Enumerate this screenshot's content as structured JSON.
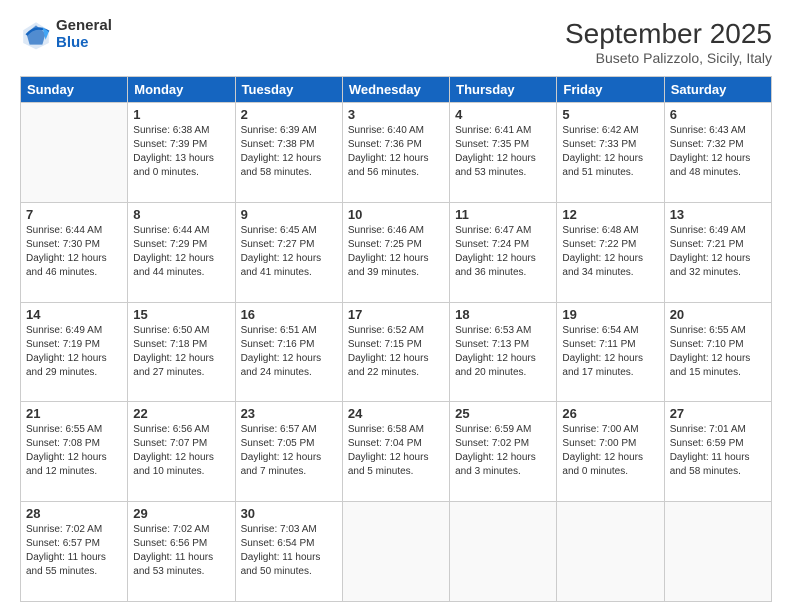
{
  "header": {
    "logo_general": "General",
    "logo_blue": "Blue",
    "month_title": "September 2025",
    "location": "Buseto Palizzolo, Sicily, Italy"
  },
  "days_of_week": [
    "Sunday",
    "Monday",
    "Tuesday",
    "Wednesday",
    "Thursday",
    "Friday",
    "Saturday"
  ],
  "weeks": [
    [
      {
        "day": "",
        "empty": true
      },
      {
        "day": "1",
        "sunrise": "6:38 AM",
        "sunset": "7:39 PM",
        "daylight": "13 hours and 0 minutes."
      },
      {
        "day": "2",
        "sunrise": "6:39 AM",
        "sunset": "7:38 PM",
        "daylight": "12 hours and 58 minutes."
      },
      {
        "day": "3",
        "sunrise": "6:40 AM",
        "sunset": "7:36 PM",
        "daylight": "12 hours and 56 minutes."
      },
      {
        "day": "4",
        "sunrise": "6:41 AM",
        "sunset": "7:35 PM",
        "daylight": "12 hours and 53 minutes."
      },
      {
        "day": "5",
        "sunrise": "6:42 AM",
        "sunset": "7:33 PM",
        "daylight": "12 hours and 51 minutes."
      },
      {
        "day": "6",
        "sunrise": "6:43 AM",
        "sunset": "7:32 PM",
        "daylight": "12 hours and 48 minutes."
      }
    ],
    [
      {
        "day": "7",
        "sunrise": "6:44 AM",
        "sunset": "7:30 PM",
        "daylight": "12 hours and 46 minutes."
      },
      {
        "day": "8",
        "sunrise": "6:44 AM",
        "sunset": "7:29 PM",
        "daylight": "12 hours and 44 minutes."
      },
      {
        "day": "9",
        "sunrise": "6:45 AM",
        "sunset": "7:27 PM",
        "daylight": "12 hours and 41 minutes."
      },
      {
        "day": "10",
        "sunrise": "6:46 AM",
        "sunset": "7:25 PM",
        "daylight": "12 hours and 39 minutes."
      },
      {
        "day": "11",
        "sunrise": "6:47 AM",
        "sunset": "7:24 PM",
        "daylight": "12 hours and 36 minutes."
      },
      {
        "day": "12",
        "sunrise": "6:48 AM",
        "sunset": "7:22 PM",
        "daylight": "12 hours and 34 minutes."
      },
      {
        "day": "13",
        "sunrise": "6:49 AM",
        "sunset": "7:21 PM",
        "daylight": "12 hours and 32 minutes."
      }
    ],
    [
      {
        "day": "14",
        "sunrise": "6:49 AM",
        "sunset": "7:19 PM",
        "daylight": "12 hours and 29 minutes."
      },
      {
        "day": "15",
        "sunrise": "6:50 AM",
        "sunset": "7:18 PM",
        "daylight": "12 hours and 27 minutes."
      },
      {
        "day": "16",
        "sunrise": "6:51 AM",
        "sunset": "7:16 PM",
        "daylight": "12 hours and 24 minutes."
      },
      {
        "day": "17",
        "sunrise": "6:52 AM",
        "sunset": "7:15 PM",
        "daylight": "12 hours and 22 minutes."
      },
      {
        "day": "18",
        "sunrise": "6:53 AM",
        "sunset": "7:13 PM",
        "daylight": "12 hours and 20 minutes."
      },
      {
        "day": "19",
        "sunrise": "6:54 AM",
        "sunset": "7:11 PM",
        "daylight": "12 hours and 17 minutes."
      },
      {
        "day": "20",
        "sunrise": "6:55 AM",
        "sunset": "7:10 PM",
        "daylight": "12 hours and 15 minutes."
      }
    ],
    [
      {
        "day": "21",
        "sunrise": "6:55 AM",
        "sunset": "7:08 PM",
        "daylight": "12 hours and 12 minutes."
      },
      {
        "day": "22",
        "sunrise": "6:56 AM",
        "sunset": "7:07 PM",
        "daylight": "12 hours and 10 minutes."
      },
      {
        "day": "23",
        "sunrise": "6:57 AM",
        "sunset": "7:05 PM",
        "daylight": "12 hours and 7 minutes."
      },
      {
        "day": "24",
        "sunrise": "6:58 AM",
        "sunset": "7:04 PM",
        "daylight": "12 hours and 5 minutes."
      },
      {
        "day": "25",
        "sunrise": "6:59 AM",
        "sunset": "7:02 PM",
        "daylight": "12 hours and 3 minutes."
      },
      {
        "day": "26",
        "sunrise": "7:00 AM",
        "sunset": "7:00 PM",
        "daylight": "12 hours and 0 minutes."
      },
      {
        "day": "27",
        "sunrise": "7:01 AM",
        "sunset": "6:59 PM",
        "daylight": "11 hours and 58 minutes."
      }
    ],
    [
      {
        "day": "28",
        "sunrise": "7:02 AM",
        "sunset": "6:57 PM",
        "daylight": "11 hours and 55 minutes."
      },
      {
        "day": "29",
        "sunrise": "7:02 AM",
        "sunset": "6:56 PM",
        "daylight": "11 hours and 53 minutes."
      },
      {
        "day": "30",
        "sunrise": "7:03 AM",
        "sunset": "6:54 PM",
        "daylight": "11 hours and 50 minutes."
      },
      {
        "day": "",
        "empty": true
      },
      {
        "day": "",
        "empty": true
      },
      {
        "day": "",
        "empty": true
      },
      {
        "day": "",
        "empty": true
      }
    ]
  ]
}
